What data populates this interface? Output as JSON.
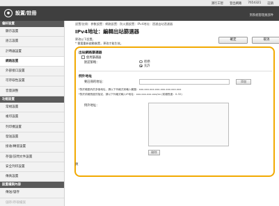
{
  "topbar": {
    "links": [
      "測行工智",
      "登出網路",
      "7654321",
      "註銷"
    ]
  },
  "header": {
    "title": "設置/註冊",
    "sub_link": "到系統管理員部件"
  },
  "sidebar": {
    "groups": [
      {
        "title": "偏好設置",
        "items": [
          "顯示設置",
          "語言設置",
          "計時器設置",
          "網路設置",
          "外部接口設置",
          "可存取性設置",
          "音量調整"
        ],
        "active_index": 3
      },
      {
        "title": "功能設置",
        "items": [
          "常規設置",
          "複印設置",
          "列印機設置",
          "發送設置",
          "接收/轉發設置",
          "存儲/訪問文件設置",
          "安全列印設置",
          "傳真設置"
        ]
      },
      {
        "title": "設置檔案內容",
        "items": [
          "傳送/儲存",
          "儲存/存取檔案"
        ]
      }
    ]
  },
  "main": {
    "breadcrumb": "設置/註冊：參數設置：網路設置：防火牆設置：IPv4地址：過濾出站過濾器",
    "page_title": "IPv4地址：編輯出站篩選器",
    "instructions": [
      "更改以下設置。",
      "* 需要重新啟動裝置，更改才能生效。"
    ],
    "ok_label": "確定",
    "cancel_label": "取消",
    "outbound_header": "出站網路篩選器",
    "use_filter_label": "使用篩選器",
    "default_policy_label": "默認策略：",
    "reject_label": "拒絕",
    "allow_label": "允許",
    "exception_header": "例外地址",
    "address_label": "要註冊的地址：",
    "add_label": "添加",
    "note1": "*對於範圍內的多個地址，請以下列格式來輸入範圍：xxx.xxx.xxx.xxx-xxx.xxx.xxx.xxx",
    "note2": "*對於前綴長度的指定，請以下列格式輸入IP地址：xxx.xxx.xxx.xxx/xx (前綴長度：0-32)",
    "exceptions_list_label": "例外地址：",
    "delete_label": "刪除",
    "footer_mark": "頁"
  },
  "colors": {
    "highlight": "#f2a900",
    "header_bg": "#3f3f3f"
  }
}
